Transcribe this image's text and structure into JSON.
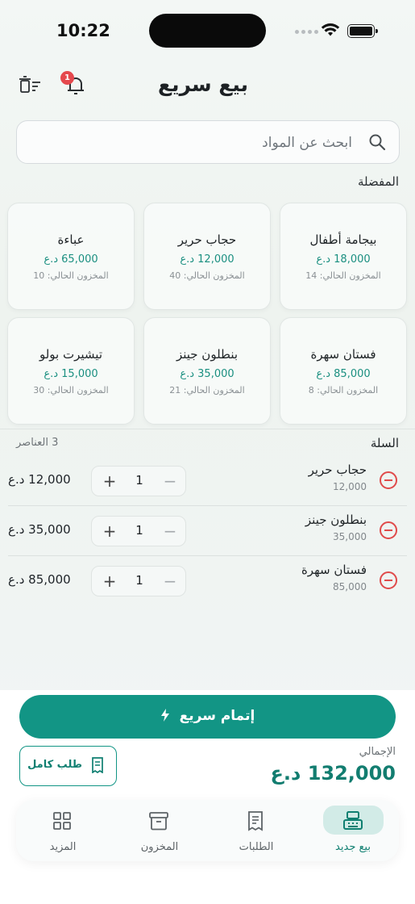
{
  "status_bar": {
    "time": "10:22"
  },
  "header": {
    "title": "بيع سريع",
    "notification_count": "1"
  },
  "search": {
    "placeholder": "ابحث عن المواد"
  },
  "favorites": {
    "label": "المفضلة",
    "items": [
      {
        "name": "بيجامة أطفال",
        "price": "18,000 د.ع",
        "stock": "المخزون الحالي: 14"
      },
      {
        "name": "حجاب حرير",
        "price": "12,000 د.ع",
        "stock": "المخزون الحالي: 40"
      },
      {
        "name": "عباءة",
        "price": "65,000 د.ع",
        "stock": "المخزون الحالي: 10"
      },
      {
        "name": "فستان سهرة",
        "price": "85,000 د.ع",
        "stock": "المخزون الحالي: 8"
      },
      {
        "name": "بنطلون جينز",
        "price": "35,000 د.ع",
        "stock": "المخزون الحالي: 21"
      },
      {
        "name": "تيشيرت بولو",
        "price": "15,000 د.ع",
        "stock": "المخزون الحالي: 30"
      }
    ]
  },
  "cart": {
    "title": "السلة",
    "count": "3 العناصر",
    "items": [
      {
        "name": "حجاب حرير",
        "unit_price": "12,000",
        "qty": "1",
        "total": "12,000 د.ع"
      },
      {
        "name": "بنطلون جينز",
        "unit_price": "35,000",
        "qty": "1",
        "total": "35,000 د.ع"
      },
      {
        "name": "فستان سهرة",
        "unit_price": "85,000",
        "qty": "1",
        "total": "85,000 د.ع"
      }
    ]
  },
  "checkout": {
    "quick_label": "إتمام سريع",
    "full_order_label": "طلب كامل",
    "total_label": "الإجمالي",
    "total_value": "132,000 د.ع"
  },
  "tabs": [
    {
      "label": "بيع جديد",
      "icon": "cash-register-icon",
      "active": true
    },
    {
      "label": "الطلبات",
      "icon": "receipt-icon",
      "active": false
    },
    {
      "label": "المخزون",
      "icon": "archive-box-icon",
      "active": false
    },
    {
      "label": "المزيد",
      "icon": "grid-icon",
      "active": false
    }
  ],
  "colors": {
    "accent": "#129585",
    "price": "#1a8f80",
    "danger": "#e04b4b",
    "badge": "#e5484d"
  }
}
